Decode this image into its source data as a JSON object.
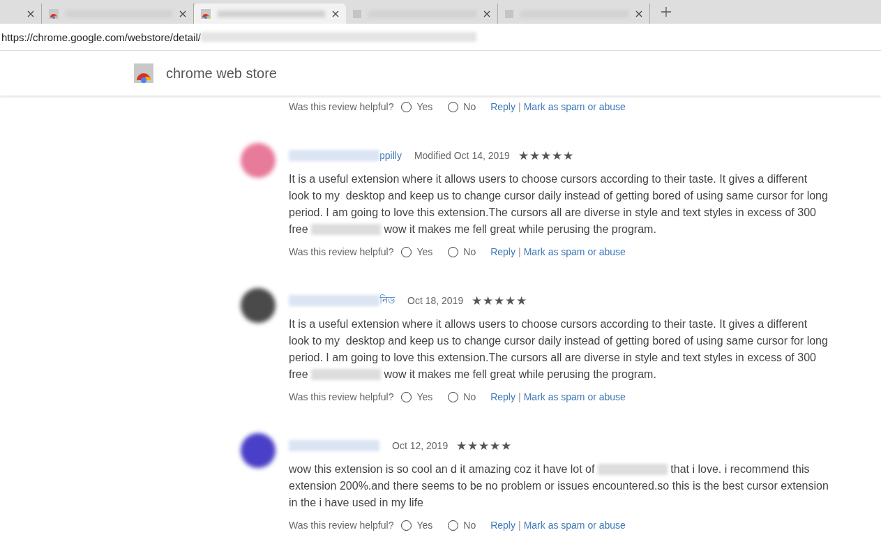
{
  "tabs": [
    {
      "favicon": false,
      "selected": false
    },
    {
      "favicon": true,
      "selected": false
    },
    {
      "favicon": true,
      "selected": true
    },
    {
      "favicon": false,
      "selected": false
    },
    {
      "favicon": false,
      "selected": false
    }
  ],
  "address": {
    "url": "https://chrome.google.com/webstore/detail/"
  },
  "header": {
    "title": "chrome web store"
  },
  "top_helpful": {
    "question": "Was this review helpful?",
    "yes": {
      "label": "Yes",
      "selected": false
    },
    "no": {
      "label": "No",
      "selected": false
    },
    "reply": "Reply",
    "separator": "|",
    "report": "Mark as spam or abuse"
  },
  "reviews": [
    {
      "color": "#e87a9a",
      "name": "ppilly",
      "date": "Modified Oct 14, 2019",
      "stars": 5,
      "body": [
        {
          "kind": "text",
          "text": "It is a useful extension where it allows users to choose cursors according to their taste. It gives a different look to my  desktop and keep us to change cursor daily instead of getting bored of using same cursor for long period. I am going to love this extension.The cursors all are diverse in style and text styles in excess of 300 free "
        },
        {
          "kind": "blur"
        },
        {
          "kind": "text",
          "text": " wow it makes me fell great while perusing the program."
        }
      ],
      "helpful": {
        "question": "Was this review helpful?",
        "yes": {
          "label": "Yes",
          "selected": false
        },
        "no": {
          "label": "No",
          "selected": false
        },
        "reply": "Reply",
        "separator": "|",
        "report": "Mark as spam or abuse"
      }
    },
    {
      "color": "#4a4a4a",
      "name": "নিড",
      "date": "Oct 18, 2019",
      "stars": 5,
      "body": [
        {
          "kind": "text",
          "text": "It is a useful extension where it allows users to choose cursors according to their taste. It gives a different look to my  desktop and keep us to change cursor daily instead of getting bored of using same cursor for long period. I am going to love this extension.The cursors all are diverse in style and text styles in excess of 300 free "
        },
        {
          "kind": "blur"
        },
        {
          "kind": "text",
          "text": " wow it makes me fell great while perusing the program."
        }
      ],
      "helpful": {
        "question": "Was this review helpful?",
        "yes": {
          "label": "Yes",
          "selected": false
        },
        "no": {
          "label": "No",
          "selected": false
        },
        "reply": "Reply",
        "separator": "|",
        "report": "Mark as spam or abuse"
      }
    },
    {
      "color": "#4a3fc8",
      "date": "Oct 12, 2019",
      "stars": 5,
      "body": [
        {
          "kind": "text",
          "text": "wow this extension is so cool an d it amazing coz it have lot of "
        },
        {
          "kind": "blur"
        },
        {
          "kind": "text",
          "text": " that i love. i recommend this extension 200%.and there seems to be no problem or issues encountered.so this is the best cursor extension in the i have used in my life"
        }
      ],
      "helpful": {
        "question": "Was this review helpful?",
        "yes": {
          "label": "Yes",
          "selected": false
        },
        "no": {
          "label": "No",
          "selected": false
        },
        "reply": "Reply",
        "separator": "|",
        "report": "Mark as spam or abuse"
      }
    }
  ]
}
